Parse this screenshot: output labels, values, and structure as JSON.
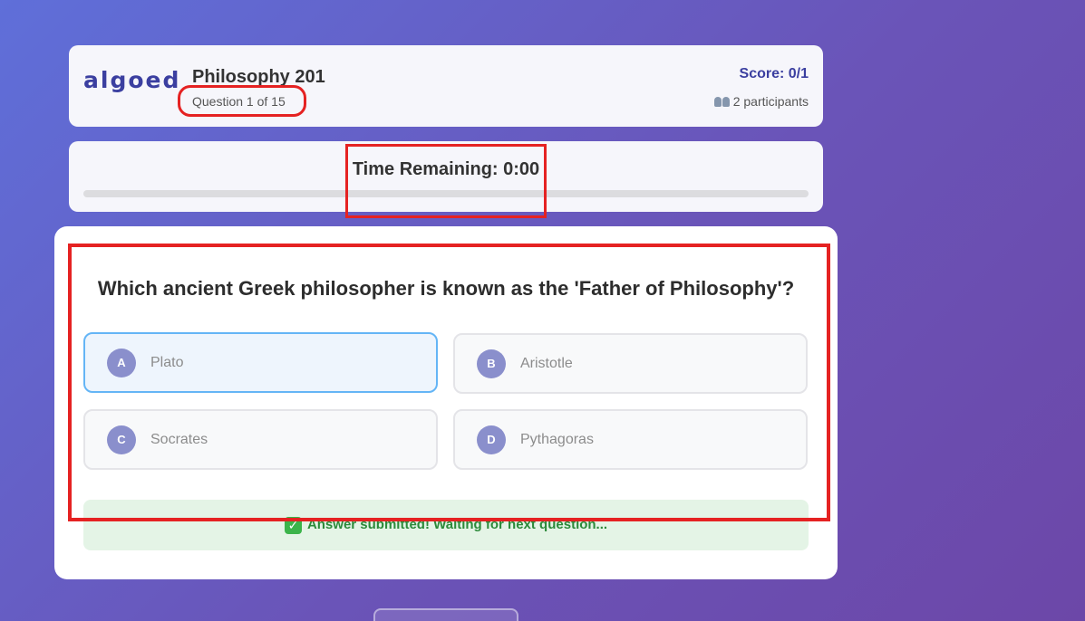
{
  "header": {
    "logo": "algoed",
    "course_title": "Philosophy 201",
    "question_count": "Question 1 of 15",
    "score": "Score: 0/1",
    "participants": "2 participants"
  },
  "timer": {
    "label": "Time Remaining: 0:00",
    "progress": 0
  },
  "question": {
    "text": "Which ancient Greek philosopher is known as the 'Father of Philosophy'?",
    "options": [
      {
        "letter": "A",
        "label": "Plato",
        "selected": true
      },
      {
        "letter": "B",
        "label": "Aristotle",
        "selected": false
      },
      {
        "letter": "C",
        "label": "Socrates",
        "selected": false
      },
      {
        "letter": "D",
        "label": "Pythagoras",
        "selected": false
      }
    ]
  },
  "status": {
    "message": "Answer submitted! Waiting for next question..."
  },
  "colors": {
    "accent": "#3b3fa0",
    "highlight": "#e52222",
    "success": "#2c8a3a"
  }
}
